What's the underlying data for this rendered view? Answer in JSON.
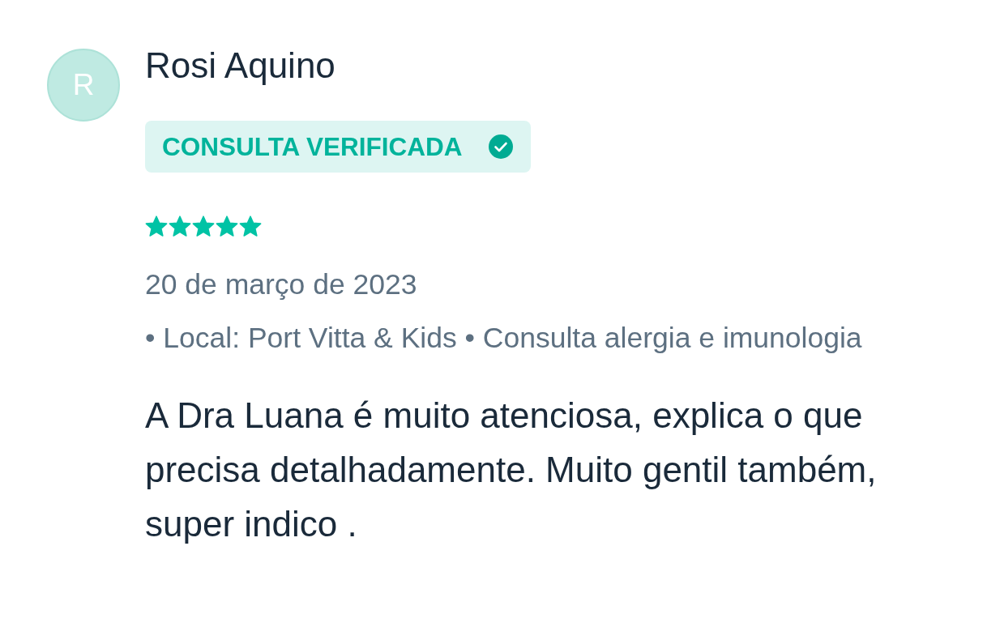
{
  "review": {
    "avatar_initial": "R",
    "author": "Rosi Aquino",
    "badge": "CONSULTA VERIFICADA",
    "stars": 5,
    "date": "20 de março de 2023",
    "details": "• Local: Port Vitta & Kids • Consulta alergia e imunologia",
    "text": "A Dra Luana é muito atenciosa, explica o que precisa detalhadamente. Muito gentil também, super indico ."
  }
}
